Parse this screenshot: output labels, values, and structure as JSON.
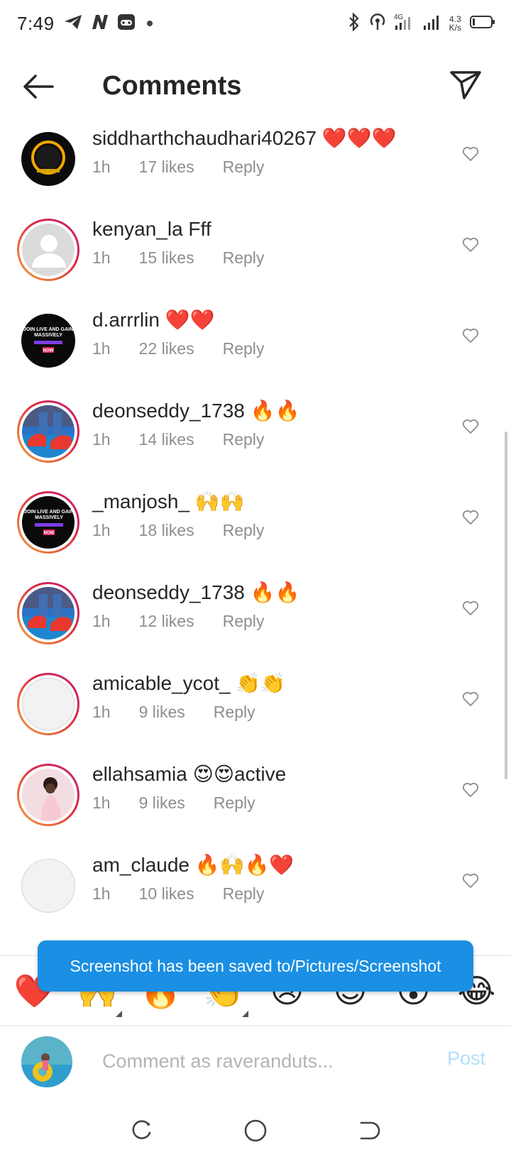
{
  "status_bar": {
    "time": "7:49",
    "network_speed_value": "4.3",
    "network_speed_unit": "K/s",
    "network_type": "4G"
  },
  "header": {
    "title": "Comments"
  },
  "comments": [
    {
      "username": "siddharthchaudhari40267",
      "text": " ❤️❤️❤️",
      "time": "1h",
      "likes": "17 likes",
      "reply": "Reply",
      "avatar_style": "plain-dark"
    },
    {
      "username": "kenyan_la",
      "text": " Fff",
      "time": "1h",
      "likes": "15 likes",
      "reply": "Reply",
      "avatar_style": "ring-default"
    },
    {
      "username": "d.arrrlin",
      "text": " ❤️❤️",
      "time": "1h",
      "likes": "22 likes",
      "reply": "Reply",
      "avatar_style": "plain-promo"
    },
    {
      "username": "deonseddy_1738",
      "text": " 🔥🔥",
      "time": "1h",
      "likes": "14 likes",
      "reply": "Reply",
      "avatar_style": "ring-shoes"
    },
    {
      "username": "_manjosh_",
      "text": " 🙌🙌",
      "time": "1h",
      "likes": "18 likes",
      "reply": "Reply",
      "avatar_style": "ring-promo"
    },
    {
      "username": "deonseddy_1738",
      "text": " 🔥🔥",
      "time": "1h",
      "likes": "12 likes",
      "reply": "Reply",
      "avatar_style": "ring-shoes"
    },
    {
      "username": "amicable_ycot_",
      "text": " 👏👏",
      "time": "1h",
      "likes": "9 likes",
      "reply": "Reply",
      "avatar_style": "ring-blank"
    },
    {
      "username": "ellahsamia",
      "text": " 😍😍active",
      "time": "1h",
      "likes": "9 likes",
      "reply": "Reply",
      "avatar_style": "ring-person"
    },
    {
      "username": "am_claude",
      "text": " 🔥🙌🔥❤️",
      "time": "1h",
      "likes": "10 likes",
      "reply": "Reply",
      "avatar_style": "plain-blank"
    }
  ],
  "promo_avatar": {
    "line1": "JOIN LIVE AND GAIN",
    "line2": "MASSIVELY",
    "badge": "NOW"
  },
  "toast": {
    "message": "Screenshot has been saved to/Pictures/Screenshot"
  },
  "emoji_bar": [
    "❤️",
    "🙌",
    "🔥",
    "👏",
    "😢",
    "😍",
    "😮",
    "😂"
  ],
  "composer": {
    "placeholder": "Comment as raveranduts...",
    "post_label": "Post"
  },
  "colors": {
    "accent_blue": "#0095f6",
    "post_disabled": "#b2dffc",
    "toast_bg": "#1a8fe3",
    "meta_gray": "#8e8e8e",
    "story_ring": [
      "#f9a03f",
      "#dc2743",
      "#bc1888"
    ]
  },
  "icons": [
    "back-arrow-icon",
    "send-icon",
    "heart-outline-icon",
    "telegram-icon",
    "bluetooth-icon",
    "hotspot-icon",
    "signal-icon",
    "battery-icon"
  ]
}
